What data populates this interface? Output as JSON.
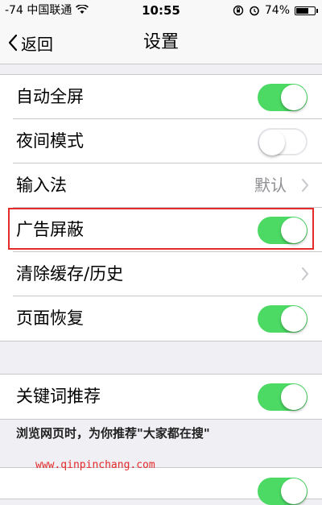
{
  "status_bar": {
    "signal": "-74",
    "carrier": "中国联通",
    "time": "10:55",
    "battery": "74%",
    "battery_level": 0.74
  },
  "nav": {
    "back_label": "返回",
    "title": "设置"
  },
  "group1": {
    "rows": [
      {
        "label": "自动全屏",
        "toggle": true
      },
      {
        "label": "夜间模式",
        "toggle": false
      },
      {
        "label": "输入法",
        "value": "默认"
      },
      {
        "label": "广告屏蔽",
        "toggle": true
      },
      {
        "label": "清除缓存/历史"
      },
      {
        "label": "页面恢复",
        "toggle": true
      }
    ]
  },
  "group2": {
    "rows": [
      {
        "label": "关键词推荐",
        "toggle": true
      }
    ],
    "footnote": "浏览网页时，为你推荐\"大家都在搜\""
  },
  "watermark": "www.qinpinchang.com",
  "colors": {
    "toggle_on": "#4cd964",
    "highlight": "#e32b2b",
    "background": "#efeff4"
  }
}
